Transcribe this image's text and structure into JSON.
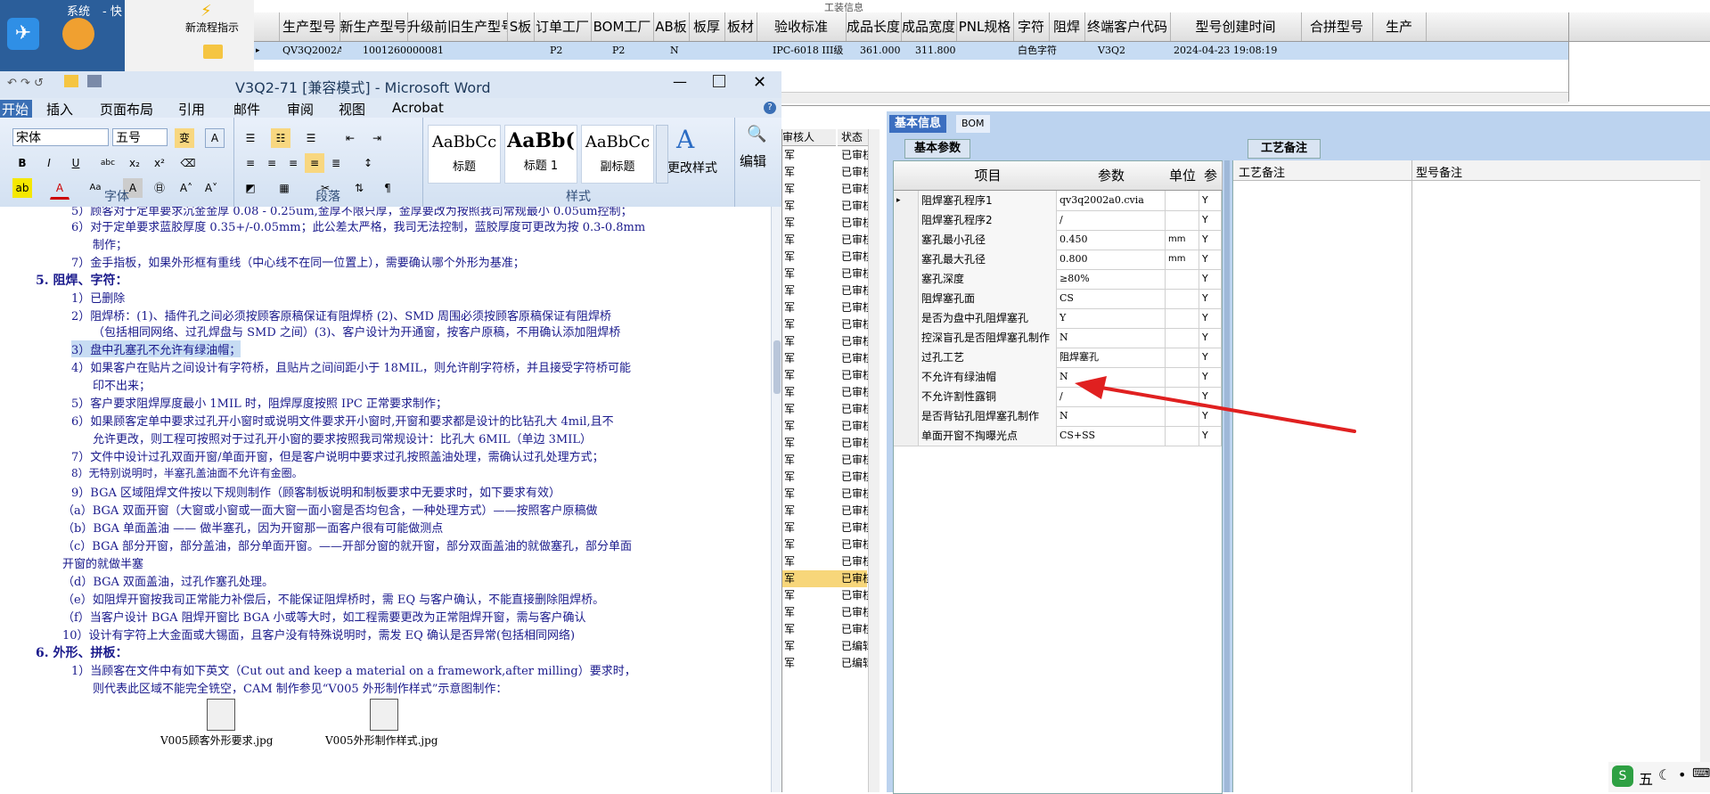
{
  "desktop": {
    "icon1_label": "系统",
    "icon2_label": "- 快",
    "new_process_label": "新流程指示",
    "partial_title": "工装信息"
  },
  "topgrid": {
    "headers": [
      "生产型号",
      "新生产型号",
      "升级前旧生产型号",
      "S板",
      "订单工厂",
      "BOM工厂",
      "AB板",
      "板厚",
      "板材",
      "验收标准",
      "成品长度",
      "成品宽度",
      "PNL规格",
      "字符",
      "阻焊",
      "终端客户代码",
      "型号创建时间",
      "合拼型号",
      "生产"
    ],
    "row": {
      "model": "QV3Q2002A0",
      "new_model": "10012600000819",
      "factory": "P2",
      "bom_factory": "P2",
      "ab": "N",
      "standard": "IPC-6018 III级",
      "length": "361.000",
      "width": "311.800",
      "char": "白色字符",
      "customer": "V3Q2",
      "created": "2024-04-23 19:08:19"
    }
  },
  "word": {
    "title": "V3Q2-71 [兼容模式] - Microsoft Word",
    "tabs": [
      "开始",
      "插入",
      "页面布局",
      "引用",
      "邮件",
      "审阅",
      "视图",
      "Acrobat"
    ],
    "font_name": "宋体",
    "font_size": "五号",
    "groups": {
      "font": "字体",
      "paragraph": "段落",
      "styles": "样式"
    },
    "styles": [
      {
        "preview": "AaBbCc",
        "name": "标题"
      },
      {
        "preview": "AaBb(",
        "name": "标题 1"
      },
      {
        "preview": "AaBbCc",
        "name": "副标题"
      }
    ],
    "change_styles": "更改样式",
    "edit": "编辑",
    "lines": [
      "5）顾客对于定单要求沉金金厚 0.08 - 0.25um,金厚不限只厚，金厚要改为按照我司常规最小 0.05um控制；",
      "6）对于定单要求蓝胶厚度 0.35+/-0.05mm；此公差太严格，我司无法控制，蓝胶厚度可更改为按 0.3-0.8mm",
      "制作；",
      "7）金手指板，如果外形框有重线（中心线不在同一位置上），需要确认哪个外形为基准；",
      "1）已删除",
      "2）阻焊桥：(1)、插件孔之间必须按顾客原稿保证有阻焊桥 (2)、SMD 周围必须按顾客原稿保证有阻焊桥",
      "（包括相同网络、过孔焊盘与 SMD 之间）(3)、客户设计为开通窗，按客户原稿，不用确认添加阻焊桥",
      "3）盘中孔塞孔不允许有绿油帽；",
      "4）如果客户在贴片之间设计有字符桥，且贴片之间间距小于 18MIL，则允许削字符桥，并且接受字符桥可能",
      "印不出来；",
      "5）客户要求阻焊厚度最小 1MIL 时，阻焊厚度按照 IPC 正常要求制作；",
      "6）如果顾客定单中要求过孔开小窗时或说明文件要求开小窗时,开窗和要求都是设计的比钻孔大 4mil,且不",
      "允许更改，则工程可按照对于过孔开小窗的要求按照我司常规设计：比孔大 6MIL（单边 3MIL）",
      "7）文件中设计过孔双面开窗/单面开窗，但是客户说明中要求过孔按照盖油处理，需确认过孔处理方式；",
      "8）无特别说明时，半塞孔盖油面不允许有金圈。",
      "9）BGA 区域阻焊文件按以下规则制作（顾客制板说明和制板要求中无要求时，如下要求有效）",
      "（a）BGA 双面开窗（大窗或小窗或一面大窗一面小窗是否均包含，一种处理方式）——按照客户原稿做",
      "（b）BGA 单面盖油 —— 做半塞孔，因为开窗那一面客户很有可能做测点",
      "（c）BGA 部分开窗，部分盖油，部分单面开窗。——开部分窗的就开窗，部分双面盖油的就做塞孔，部分单面",
      "开窗的就做半塞",
      "（d）BGA 双面盖油，过孔作塞孔处理。",
      "（e）如阻焊开窗按我司正常能力补偿后，不能保证阻焊桥时，需 EQ 与客户确认，不能直接删除阻焊桥。",
      "（f）当客户设计 BGA 阻焊开窗比 BGA 小或等大时，如工程需要更改为正常阻焊开窗，需与客户确认",
      "10）设计有字符上大金面或大锡面，且客户没有特殊说明时，需发 EQ 确认是否异常(包括相同网络)",
      "1）当顾客在文件中有如下英文（Cut out and keep a material on a framework,after milling）要求时，",
      "则代表此区域不能完全铣空，CAM 制作参见“V005 外形制作样式”示意图制作：",
      "V005顾客外形要求.jpg",
      "V005外形制作样式.jpg"
    ],
    "heading5": "5.  阻焊、字符：",
    "heading6": "6.  外形、拼板："
  },
  "midlist": {
    "col1": "审核人",
    "col2": "状态",
    "row_text1": "军",
    "row_text2": "已审核",
    "row_alt": "已编辑"
  },
  "rightpanel": {
    "tab_basic": "基本信息",
    "tab_bom": "BOM",
    "sub_basic": "基本参数",
    "sub_notes": "工艺备注",
    "grid_headers": [
      "项目",
      "参数",
      "单位",
      "参"
    ],
    "rows": [
      {
        "item": "阻焊塞孔程序1",
        "param": "qv3q2002a0.cvia",
        "unit": "",
        "flag": "Y"
      },
      {
        "item": "阻焊塞孔程序2",
        "param": "/",
        "unit": "",
        "flag": "Y"
      },
      {
        "item": "塞孔最小孔径",
        "param": "0.450",
        "unit": "mm",
        "flag": "Y"
      },
      {
        "item": "塞孔最大孔径",
        "param": "0.800",
        "unit": "mm",
        "flag": "Y"
      },
      {
        "item": "塞孔深度",
        "param": "≥80%",
        "unit": "",
        "flag": "Y"
      },
      {
        "item": "阻焊塞孔面",
        "param": "CS",
        "unit": "",
        "flag": "Y"
      },
      {
        "item": "是否为盘中孔阻焊塞孔",
        "param": "Y",
        "unit": "",
        "flag": "Y"
      },
      {
        "item": "控深盲孔是否阻焊塞孔制作",
        "param": "N",
        "unit": "",
        "flag": "Y"
      },
      {
        "item": "过孔工艺",
        "param": "阻焊塞孔",
        "unit": "",
        "flag": "Y"
      },
      {
        "item": "不允许有绿油帽",
        "param": "N",
        "unit": "",
        "flag": "Y"
      },
      {
        "item": "不允许割性露铜",
        "param": "/",
        "unit": "",
        "flag": "Y"
      },
      {
        "item": "是否背钻孔阻焊塞孔制作",
        "param": "N",
        "unit": "",
        "flag": "Y"
      },
      {
        "item": "单面开窗不掏曝光点",
        "param": "CS+SS",
        "unit": "",
        "flag": "Y"
      }
    ],
    "notes_headers": [
      "工艺备注",
      "型号备注"
    ]
  },
  "taskbar": {
    "ime": "五"
  },
  "colors": {
    "accent": "#3b6ec0",
    "arrow": "#e02020",
    "selected_row": "#c7dcf3"
  }
}
